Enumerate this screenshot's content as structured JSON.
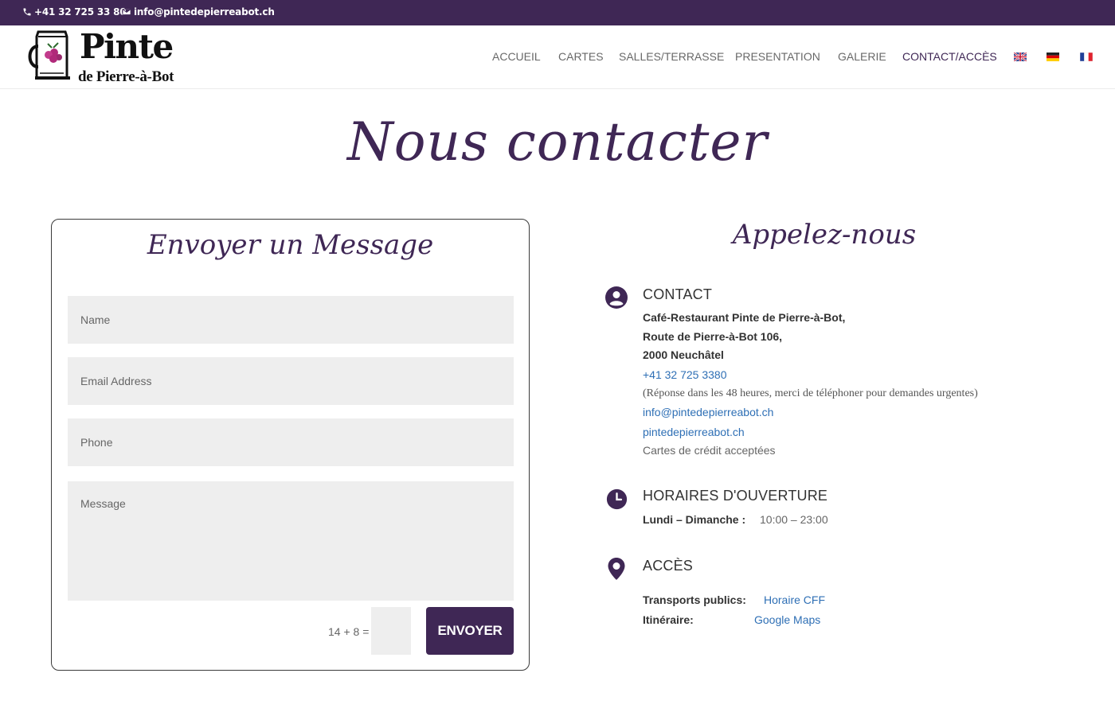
{
  "topbar": {
    "phone": "+41 32 725 33 80",
    "email": "info@pintedepierreabot.ch"
  },
  "brand": {
    "name": "Pinte",
    "subtitle": "de Pierre-à-Bot"
  },
  "nav": {
    "items": [
      "ACCUEIL",
      "CARTES",
      "SALLES/TERRASSE",
      "PRESENTATION",
      "GALERIE",
      "CONTACT/ACCÈS"
    ],
    "active": "CONTACT/ACCÈS",
    "flags": [
      "english-flag-icon",
      "german-flag-icon",
      "french-flag-icon"
    ]
  },
  "page": {
    "title": "Nous contacter"
  },
  "form": {
    "title": "Envoyer un Message",
    "name_placeholder": "Name",
    "email_placeholder": "Email Address",
    "phone_placeholder": "Phone",
    "message_placeholder": "Message",
    "captcha_question": "14 + 8 =",
    "submit_label": "ENVOYER"
  },
  "contact": {
    "title": "Appelez-nous",
    "contact_heading": "CONTACT",
    "address_line1": "Café-Restaurant Pinte de Pierre-à-Bot,",
    "address_line2": "Route de Pierre-à-Bot 106,",
    "address_line3": "2000 Neuchâtel",
    "phone": "+41 32 725 3380",
    "note": "(Réponse dans les 48 heures, merci de téléphoner pour demandes urgentes)",
    "email": "info@pintedepierreabot.ch",
    "website": "pintedepierreabot.ch",
    "cards": "Cartes de crédit acceptées",
    "hours_heading": "HORAIRES D'OUVERTURE",
    "hours_days": "Lundi – Dimanche :",
    "hours_time": "10:00 – 23:00",
    "access_heading": "ACCÈS",
    "transport_label": "Transports publics:",
    "transport_link": "Horaire CFF",
    "route_label": "Itinéraire:",
    "route_link": "Google Maps"
  },
  "colors": {
    "brand_purple": "#3f2755",
    "link_blue": "#2e6fb5",
    "field_gray": "#eeeeee"
  }
}
